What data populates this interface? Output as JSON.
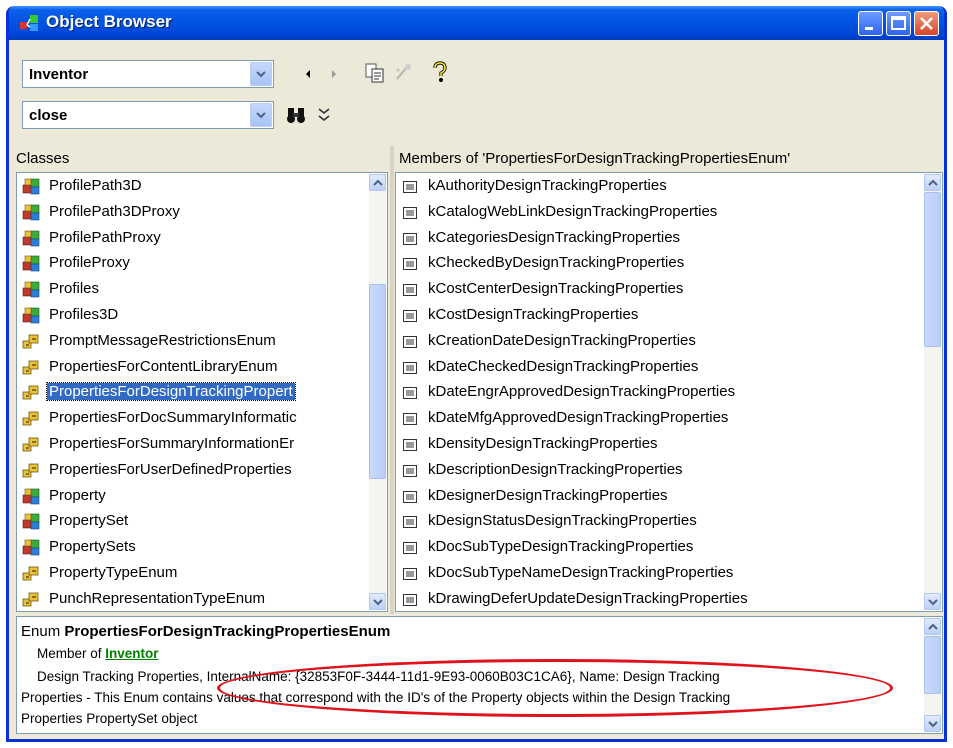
{
  "window": {
    "title": "Object Browser"
  },
  "toolbar": {
    "library_value": "Inventor",
    "search_value": "close"
  },
  "classes_pane": {
    "header": "Classes",
    "items": [
      {
        "label": "ProfilePath3D",
        "icon": "class-icon"
      },
      {
        "label": "ProfilePath3DProxy",
        "icon": "class-icon"
      },
      {
        "label": "ProfilePathProxy",
        "icon": "class-icon"
      },
      {
        "label": "ProfileProxy",
        "icon": "class-icon"
      },
      {
        "label": "Profiles",
        "icon": "class-icon"
      },
      {
        "label": "Profiles3D",
        "icon": "class-icon"
      },
      {
        "label": "PromptMessageRestrictionsEnum",
        "icon": "enum-icon"
      },
      {
        "label": "PropertiesForContentLibraryEnum",
        "icon": "enum-icon"
      },
      {
        "label": "PropertiesForDesignTrackingPropert",
        "icon": "enum-icon",
        "selected": true
      },
      {
        "label": "PropertiesForDocSummaryInformatic",
        "icon": "enum-icon"
      },
      {
        "label": "PropertiesForSummaryInformationEr",
        "icon": "enum-icon"
      },
      {
        "label": "PropertiesForUserDefinedProperties",
        "icon": "enum-icon"
      },
      {
        "label": "Property",
        "icon": "class-icon"
      },
      {
        "label": "PropertySet",
        "icon": "class-icon"
      },
      {
        "label": "PropertySets",
        "icon": "class-icon"
      },
      {
        "label": "PropertyTypeEnum",
        "icon": "enum-icon"
      },
      {
        "label": "PunchRepresentationTypeEnum",
        "icon": "enum-icon"
      }
    ]
  },
  "members_pane": {
    "header": "Members of 'PropertiesForDesignTrackingPropertiesEnum'",
    "items": [
      "kAuthorityDesignTrackingProperties",
      "kCatalogWebLinkDesignTrackingProperties",
      "kCategoriesDesignTrackingProperties",
      "kCheckedByDesignTrackingProperties",
      "kCostCenterDesignTrackingProperties",
      "kCostDesignTrackingProperties",
      "kCreationDateDesignTrackingProperties",
      "kDateCheckedDesignTrackingProperties",
      "kDateEngrApprovedDesignTrackingProperties",
      "kDateMfgApprovedDesignTrackingProperties",
      "kDensityDesignTrackingProperties",
      "kDescriptionDesignTrackingProperties",
      "kDesignerDesignTrackingProperties",
      "kDesignStatusDesignTrackingProperties",
      "kDocSubTypeDesignTrackingProperties",
      "kDocSubTypeNameDesignTrackingProperties",
      "kDrawingDeferUpdateDesignTrackingProperties"
    ]
  },
  "description": {
    "kind": "Enum",
    "name": "PropertiesForDesignTrackingPropertiesEnum",
    "member_of_prefix": "Member of",
    "member_of_link": "Inventor",
    "line1": "Design Tracking Properties, InternalName: {32853F0F-3444-11d1-9E93-0060B03C1CA6}, Name: Design Tracking",
    "line2": "Properties - This Enum contains values that correspond with the ID's of the Property objects within the Design Tracking",
    "line3": "Properties PropertySet object"
  },
  "colors": {
    "titlebar": "#0054e3",
    "selection": "#316ac5",
    "annotation": "#e0131b",
    "link": "#008000"
  }
}
